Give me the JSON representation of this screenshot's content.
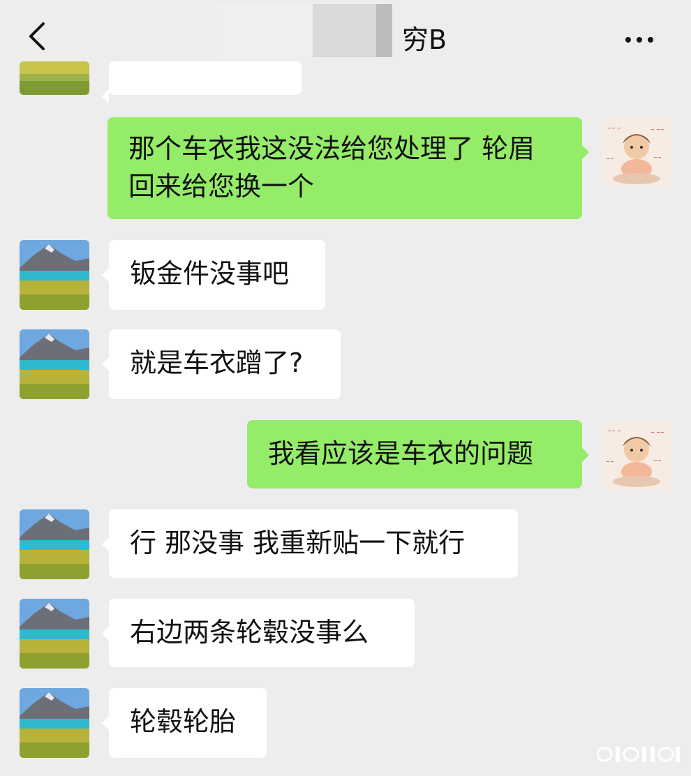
{
  "header": {
    "title": "穷B",
    "back_icon": "chevron-left-icon",
    "more_icon": "more-dots-icon"
  },
  "colors": {
    "background": "#ededed",
    "incoming_bubble": "#ffffff",
    "outgoing_bubble": "#95ec69"
  },
  "messages": [
    {
      "side": "left",
      "text": ""
    },
    {
      "side": "right",
      "text": "那个车衣我这没法给您处理了   轮眉回来给您换一个"
    },
    {
      "side": "left",
      "text": "钣金件没事吧"
    },
    {
      "side": "left",
      "text": "就是车衣蹭了?"
    },
    {
      "side": "right",
      "text": "我看应该是车衣的问题"
    },
    {
      "side": "left",
      "text": "行 那没事 我重新贴一下就行"
    },
    {
      "side": "left",
      "text": "右边两条轮毂没事么"
    },
    {
      "side": "left",
      "text": "轮毂轮胎"
    }
  ]
}
